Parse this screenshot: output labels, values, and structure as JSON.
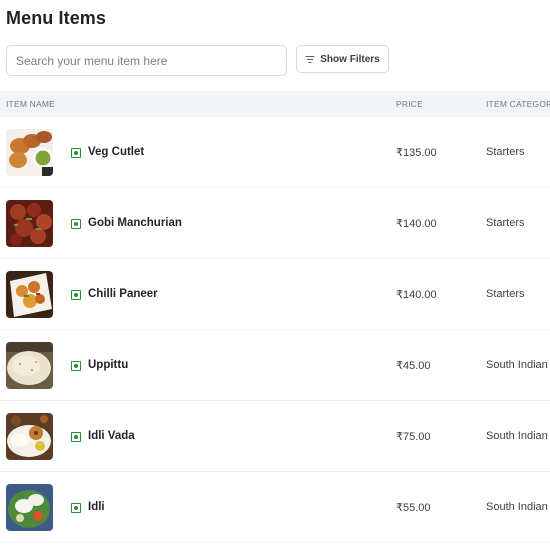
{
  "page": {
    "title": "Menu Items"
  },
  "search": {
    "placeholder": "Search your menu item here",
    "value": ""
  },
  "filters": {
    "button_label": "Show Filters",
    "icon": "filter-icon"
  },
  "table": {
    "columns": {
      "name": "ITEM NAME",
      "price": "PRICE",
      "category": "ITEM CATEGORY"
    },
    "rows": [
      {
        "name": "Veg Cutlet",
        "price": "₹135.00",
        "category": "Starters",
        "veg": true
      },
      {
        "name": "Gobi Manchurian",
        "price": "₹140.00",
        "category": "Starters",
        "veg": true
      },
      {
        "name": "Chilli Paneer",
        "price": "₹140.00",
        "category": "Starters",
        "veg": true
      },
      {
        "name": "Uppittu",
        "price": "₹45.00",
        "category": "South Indian",
        "veg": true
      },
      {
        "name": "Idli Vada",
        "price": "₹75.00",
        "category": "South Indian",
        "veg": true
      },
      {
        "name": "Idli",
        "price": "₹55.00",
        "category": "South Indian",
        "veg": true
      }
    ]
  },
  "colors": {
    "veg_green": "#2e8b37",
    "header_bg": "#f3f4f6",
    "border": "#d8dbe0"
  }
}
